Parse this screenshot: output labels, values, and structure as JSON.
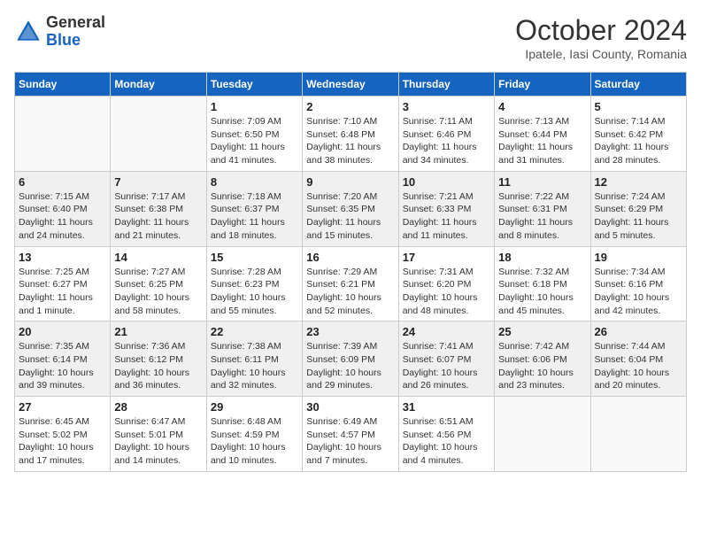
{
  "header": {
    "logo_general": "General",
    "logo_blue": "Blue",
    "month_title": "October 2024",
    "location": "Ipatele, Iasi County, Romania"
  },
  "days_of_week": [
    "Sunday",
    "Monday",
    "Tuesday",
    "Wednesday",
    "Thursday",
    "Friday",
    "Saturday"
  ],
  "weeks": [
    [
      {
        "day": "",
        "info": ""
      },
      {
        "day": "",
        "info": ""
      },
      {
        "day": "1",
        "info": "Sunrise: 7:09 AM\nSunset: 6:50 PM\nDaylight: 11 hours and 41 minutes."
      },
      {
        "day": "2",
        "info": "Sunrise: 7:10 AM\nSunset: 6:48 PM\nDaylight: 11 hours and 38 minutes."
      },
      {
        "day": "3",
        "info": "Sunrise: 7:11 AM\nSunset: 6:46 PM\nDaylight: 11 hours and 34 minutes."
      },
      {
        "day": "4",
        "info": "Sunrise: 7:13 AM\nSunset: 6:44 PM\nDaylight: 11 hours and 31 minutes."
      },
      {
        "day": "5",
        "info": "Sunrise: 7:14 AM\nSunset: 6:42 PM\nDaylight: 11 hours and 28 minutes."
      }
    ],
    [
      {
        "day": "6",
        "info": "Sunrise: 7:15 AM\nSunset: 6:40 PM\nDaylight: 11 hours and 24 minutes."
      },
      {
        "day": "7",
        "info": "Sunrise: 7:17 AM\nSunset: 6:38 PM\nDaylight: 11 hours and 21 minutes."
      },
      {
        "day": "8",
        "info": "Sunrise: 7:18 AM\nSunset: 6:37 PM\nDaylight: 11 hours and 18 minutes."
      },
      {
        "day": "9",
        "info": "Sunrise: 7:20 AM\nSunset: 6:35 PM\nDaylight: 11 hours and 15 minutes."
      },
      {
        "day": "10",
        "info": "Sunrise: 7:21 AM\nSunset: 6:33 PM\nDaylight: 11 hours and 11 minutes."
      },
      {
        "day": "11",
        "info": "Sunrise: 7:22 AM\nSunset: 6:31 PM\nDaylight: 11 hours and 8 minutes."
      },
      {
        "day": "12",
        "info": "Sunrise: 7:24 AM\nSunset: 6:29 PM\nDaylight: 11 hours and 5 minutes."
      }
    ],
    [
      {
        "day": "13",
        "info": "Sunrise: 7:25 AM\nSunset: 6:27 PM\nDaylight: 11 hours and 1 minute."
      },
      {
        "day": "14",
        "info": "Sunrise: 7:27 AM\nSunset: 6:25 PM\nDaylight: 10 hours and 58 minutes."
      },
      {
        "day": "15",
        "info": "Sunrise: 7:28 AM\nSunset: 6:23 PM\nDaylight: 10 hours and 55 minutes."
      },
      {
        "day": "16",
        "info": "Sunrise: 7:29 AM\nSunset: 6:21 PM\nDaylight: 10 hours and 52 minutes."
      },
      {
        "day": "17",
        "info": "Sunrise: 7:31 AM\nSunset: 6:20 PM\nDaylight: 10 hours and 48 minutes."
      },
      {
        "day": "18",
        "info": "Sunrise: 7:32 AM\nSunset: 6:18 PM\nDaylight: 10 hours and 45 minutes."
      },
      {
        "day": "19",
        "info": "Sunrise: 7:34 AM\nSunset: 6:16 PM\nDaylight: 10 hours and 42 minutes."
      }
    ],
    [
      {
        "day": "20",
        "info": "Sunrise: 7:35 AM\nSunset: 6:14 PM\nDaylight: 10 hours and 39 minutes."
      },
      {
        "day": "21",
        "info": "Sunrise: 7:36 AM\nSunset: 6:12 PM\nDaylight: 10 hours and 36 minutes."
      },
      {
        "day": "22",
        "info": "Sunrise: 7:38 AM\nSunset: 6:11 PM\nDaylight: 10 hours and 32 minutes."
      },
      {
        "day": "23",
        "info": "Sunrise: 7:39 AM\nSunset: 6:09 PM\nDaylight: 10 hours and 29 minutes."
      },
      {
        "day": "24",
        "info": "Sunrise: 7:41 AM\nSunset: 6:07 PM\nDaylight: 10 hours and 26 minutes."
      },
      {
        "day": "25",
        "info": "Sunrise: 7:42 AM\nSunset: 6:06 PM\nDaylight: 10 hours and 23 minutes."
      },
      {
        "day": "26",
        "info": "Sunrise: 7:44 AM\nSunset: 6:04 PM\nDaylight: 10 hours and 20 minutes."
      }
    ],
    [
      {
        "day": "27",
        "info": "Sunrise: 6:45 AM\nSunset: 5:02 PM\nDaylight: 10 hours and 17 minutes."
      },
      {
        "day": "28",
        "info": "Sunrise: 6:47 AM\nSunset: 5:01 PM\nDaylight: 10 hours and 14 minutes."
      },
      {
        "day": "29",
        "info": "Sunrise: 6:48 AM\nSunset: 4:59 PM\nDaylight: 10 hours and 10 minutes."
      },
      {
        "day": "30",
        "info": "Sunrise: 6:49 AM\nSunset: 4:57 PM\nDaylight: 10 hours and 7 minutes."
      },
      {
        "day": "31",
        "info": "Sunrise: 6:51 AM\nSunset: 4:56 PM\nDaylight: 10 hours and 4 minutes."
      },
      {
        "day": "",
        "info": ""
      },
      {
        "day": "",
        "info": ""
      }
    ]
  ]
}
